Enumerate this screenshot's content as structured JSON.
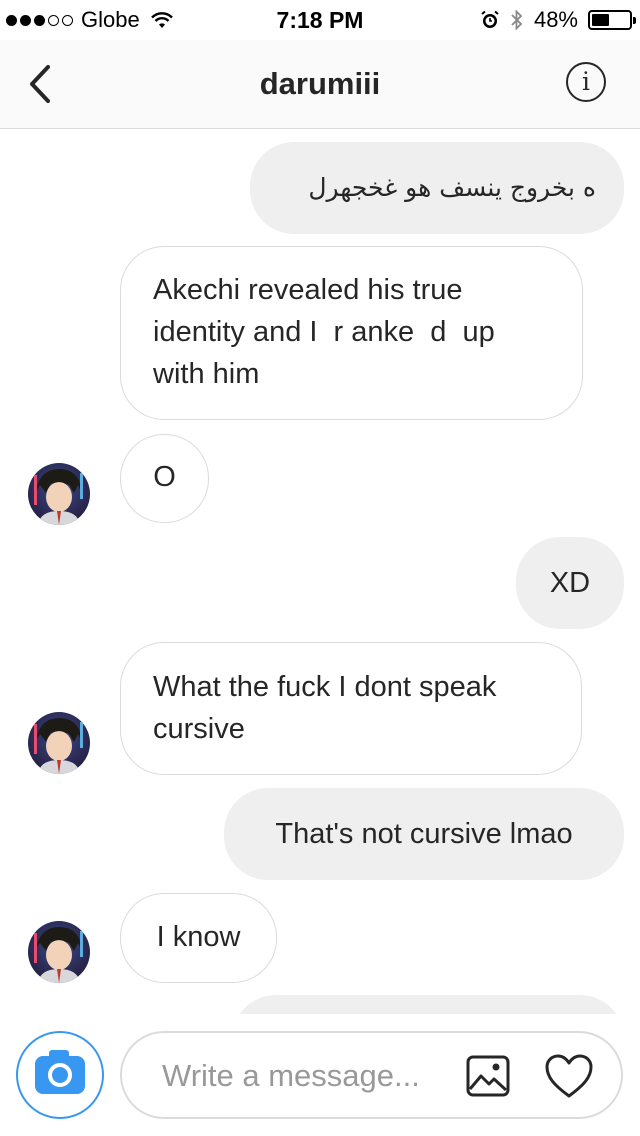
{
  "status_bar": {
    "carrier": "Globe",
    "time": "7:18 PM",
    "battery": "48%",
    "battery_level": 0.48,
    "signal_bars": 3,
    "icons": [
      "signal-dots",
      "wifi-icon",
      "alarm-icon",
      "bluetooth-icon",
      "battery-icon"
    ]
  },
  "nav": {
    "title": "darumiii",
    "back_icon": "chevron-left-icon",
    "info_label": "i"
  },
  "messages": [
    {
      "sender": "me",
      "lines": [
        "ه بخروج ينسف هو غخجهرل"
      ]
    },
    {
      "sender": "them",
      "lines": [
        "Akechi revealed his true",
        "identity and I  r anke  d  up",
        "with him"
      ]
    },
    {
      "sender": "them",
      "lines": [
        "O"
      ],
      "avatar": true
    },
    {
      "sender": "me",
      "lines": [
        "XD"
      ]
    },
    {
      "sender": "them",
      "lines": [
        "What the fuck I dont speak",
        "cursive"
      ],
      "avatar": true
    },
    {
      "sender": "me",
      "lines": [
        "That's not cursive lmao"
      ]
    },
    {
      "sender": "them",
      "lines": [
        "I know"
      ],
      "avatar": true
    }
  ],
  "composer": {
    "placeholder": "Write a message...",
    "camera_icon": "camera-icon",
    "gallery_icon": "image-icon",
    "like_icon": "heart-icon"
  },
  "colors": {
    "accent": "#3897f0",
    "outgoing_bubble": "#efefef",
    "incoming_border": "#dbdbdb",
    "text": "#262626",
    "placeholder": "#999999"
  }
}
